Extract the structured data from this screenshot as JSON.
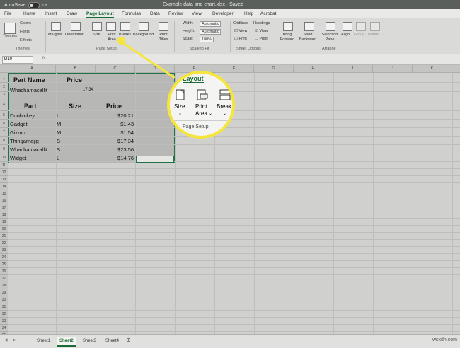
{
  "titlebar": {
    "autosave": "AutoSave",
    "toggle": "Off",
    "doc_title": "Example data and chart.xlsx  -  Saved"
  },
  "tabs": [
    "File",
    "Home",
    "Insert",
    "Draw",
    "Page Layout",
    "Formulas",
    "Data",
    "Review",
    "View",
    "Developer",
    "Help",
    "Acrobat"
  ],
  "ribbon": {
    "themes": {
      "big": "Themes",
      "colors": "Colors",
      "fonts": "Fonts",
      "effects": "Effects",
      "group": "Themes"
    },
    "page_setup": {
      "margins": "Margins",
      "orientation": "Orientation",
      "size": "Size",
      "print_area": "Print Area",
      "breaks": "Breaks",
      "background": "Background",
      "print_titles": "Print Titles",
      "group": "Page Setup"
    },
    "scale": {
      "width": "Width:",
      "height": "Height:",
      "scale": "Scale:",
      "auto1": "Automatic",
      "auto2": "Automatic",
      "pct": "100%",
      "group": "Scale to Fit"
    },
    "sheet_options": {
      "gridlines": "Gridlines",
      "headings": "Headings",
      "view": "View",
      "print": "Print",
      "group": "Sheet Options"
    },
    "arrange": {
      "forward": "Bring Forward",
      "backward": "Send Backward",
      "selection": "Selection Pane",
      "align": "Align",
      "group_btn": "Group",
      "rotate": "Rotate",
      "group": "Arrange"
    }
  },
  "formula": {
    "namebox": "D10",
    "fx": "fx"
  },
  "columns": [
    "A",
    "B",
    "C",
    "D",
    "E",
    "F",
    "G",
    "H",
    "I",
    "J",
    "K",
    "L"
  ],
  "rows": [
    "1",
    "2",
    "3",
    "4",
    "5",
    "6",
    "7",
    "8",
    "9",
    "10",
    "11",
    "12",
    "13",
    "14",
    "15",
    "16",
    "17",
    "18",
    "19",
    "20",
    "21",
    "22",
    "23",
    "24",
    "25",
    "26",
    "27",
    "28",
    "29",
    "30",
    "31",
    "32",
    "33",
    "34",
    "35",
    "36",
    "37"
  ],
  "cells": {
    "a1": "Part Name",
    "b1": "Price",
    "a2": "Whachamacallit",
    "b2": "17.34",
    "a4": "Part",
    "b4": "Size",
    "c4": "Price",
    "data": [
      {
        "part": "Doohickey",
        "size": "L",
        "price": "$20.21"
      },
      {
        "part": "Gadget",
        "size": "M",
        "price": "$1.43"
      },
      {
        "part": "Gizmo",
        "size": "M",
        "price": "$1.54"
      },
      {
        "part": "Thingamajig",
        "size": "S",
        "price": "$17.34"
      },
      {
        "part": "Whachamacallit",
        "size": "S",
        "price": "$23.56"
      },
      {
        "part": "Widget",
        "size": "L",
        "price": "$14.76"
      }
    ]
  },
  "magnifier": {
    "tab": "Layout",
    "size": "Size",
    "print": "Print",
    "area": "Area",
    "breaks": "Break",
    "group": "Page Setup"
  },
  "sheets": [
    "Sheet1",
    "Sheet2",
    "Sheet3",
    "Sheet4"
  ],
  "watermark": "wsxdn.com",
  "colors": {
    "accent": "#217346",
    "callout": "#f5e53c"
  }
}
